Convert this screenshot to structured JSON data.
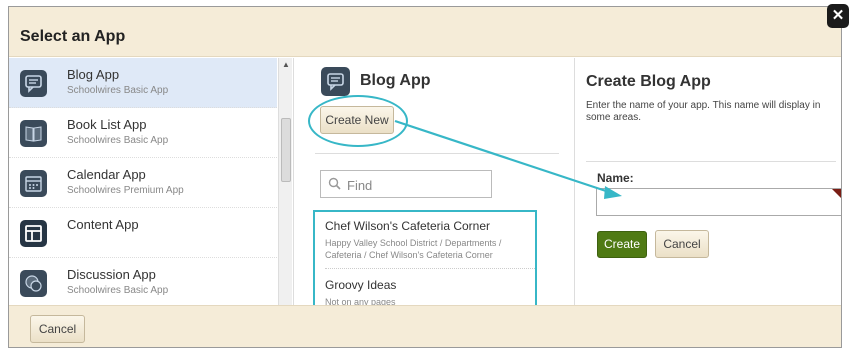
{
  "dialog": {
    "title": "Select an App",
    "close_label": "✕"
  },
  "app_list": [
    {
      "name": "Blog App",
      "sub": "Schoolwires Basic App",
      "icon": "chat-bubble-icon",
      "selected": true
    },
    {
      "name": "Book List App",
      "sub": "Schoolwires Basic App",
      "icon": "book-icon"
    },
    {
      "name": "Calendar App",
      "sub": "Schoolwires Premium App",
      "icon": "calendar-icon"
    },
    {
      "name": "Content App",
      "sub": "",
      "icon": "content-layout-icon"
    },
    {
      "name": "Discussion App",
      "sub": "Schoolwires Basic App",
      "icon": "discussion-icon"
    }
  ],
  "middle": {
    "title": "Blog App",
    "create_new_label": "Create New",
    "search_placeholder": "Find",
    "results": [
      {
        "title": "Chef Wilson's Cafeteria Corner",
        "path": "Happy Valley School District / Departments / Cafeteria / Chef Wilson's Cafeteria Corner"
      },
      {
        "title": "Groovy Ideas",
        "path": "Not on any pages"
      }
    ]
  },
  "right": {
    "title": "Create Blog App",
    "description": "Enter the name of your app. This name will display in some areas.",
    "name_label": "Name:",
    "name_value": "",
    "create_label": "Create",
    "cancel_label": "Cancel"
  },
  "footer": {
    "cancel_label": "Cancel"
  },
  "colors": {
    "accent": "#37b7c7",
    "header_bg": "#f5ecd8",
    "create_green": "#4f7a14",
    "selected_bg": "#dfe9f7"
  }
}
